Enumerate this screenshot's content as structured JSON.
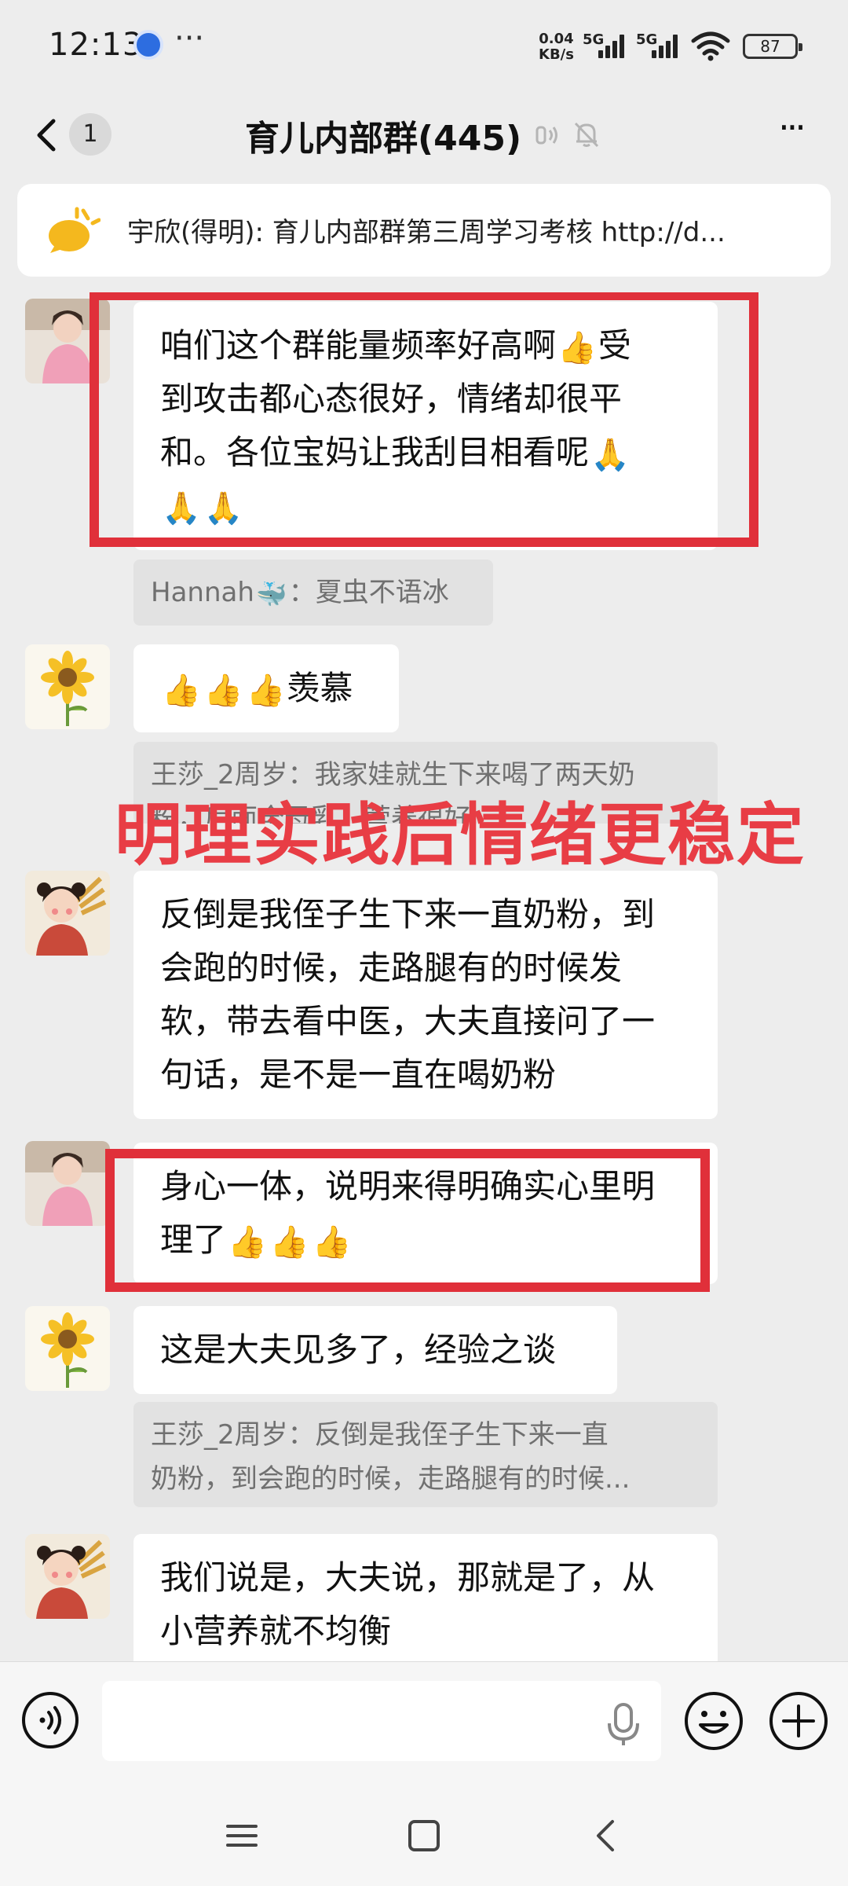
{
  "status_bar": {
    "time": "12:13",
    "more": "···",
    "net_speed_value": "0.04",
    "net_speed_unit": "KB/s",
    "network_1": "5G",
    "network_2": "5G",
    "battery": "87"
  },
  "header": {
    "unread_count": "1",
    "title": "育儿内部群(445)"
  },
  "pinned": {
    "text": "宇欣(得明): 育儿内部群第三周学习考核  http://d..."
  },
  "messages": [
    {
      "avatar": "woman-pink-avatar",
      "text_line_1": "咱们这个群能量频率好高啊",
      "text_line_1_tail": "受",
      "text_line_2": "到攻击都心态很好，情绪却很平",
      "text_line_3": "和。各位宝妈让我刮目相看呢",
      "emoji_thumbs": "👍",
      "emoji_pray": "🙏",
      "quote_name": "Hannah",
      "quote_emoji": "🐳",
      "quote_text": "：夏虫不语冰"
    },
    {
      "avatar": "sunflower-avatar",
      "text_tail": "羡慕",
      "quote_name": "王莎_2周岁",
      "quote_text": "：我家娃就生下来喝了两天奶",
      "quote_line_2": "粉，后面全母乳，营养很好"
    },
    {
      "avatar": "girl-wheat-avatar",
      "text_line_1": "反倒是我侄子生下来一直奶粉，到",
      "text_line_2": "会跑的时候，走路腿有的时候发",
      "text_line_3": "软，带去看中医，大夫直接问了一",
      "text_line_4": "句话，是不是一直在喝奶粉"
    },
    {
      "avatar": "woman-pink-avatar",
      "text_line_1": "身心一体，说明来得明确实心里明",
      "text_line_2": "理了"
    },
    {
      "avatar": "sunflower-avatar",
      "text": "这是大夫见多了，经验之谈",
      "quote_name": "王莎_2周岁",
      "quote_text": "：反倒是我侄子生下来一直",
      "quote_line_2": "奶粉，到会跑的时候，走路腿有的时候..."
    },
    {
      "avatar": "girl-wheat-avatar",
      "text_line_1": "我们说是，大夫说，那就是了，从",
      "text_line_2": "小营养就不均衡"
    }
  ],
  "overlay_caption": "明理实践后情绪更稳定",
  "input": {
    "placeholder": "",
    "value": ""
  },
  "colors": {
    "background": "#ededed",
    "bubble": "#ffffff",
    "quote": "#e2e2e2",
    "highlight": "#e0303a",
    "caption": "#e83d45"
  }
}
